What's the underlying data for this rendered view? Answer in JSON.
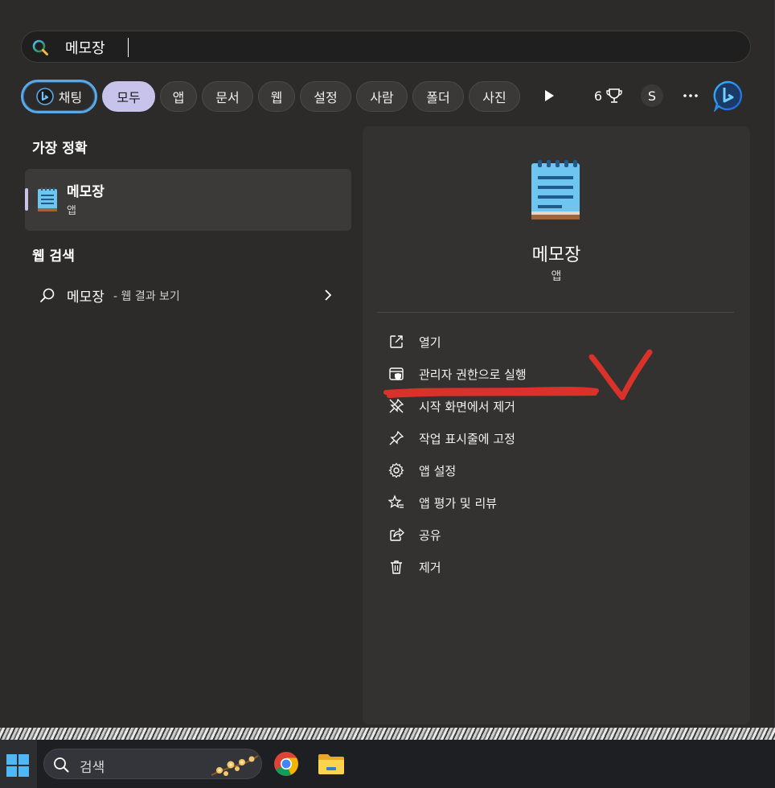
{
  "search": {
    "query": "메모장",
    "icon": "search-icon"
  },
  "filters": {
    "chat": "채팅",
    "items": [
      "모두",
      "앱",
      "문서",
      "웹",
      "설정",
      "사람",
      "폴더",
      "사진"
    ],
    "active": "모두",
    "play_icon": "play-icon",
    "points": "6",
    "points_icon": "rewards-trophy-icon",
    "avatar_letter": "S",
    "more_icon": "more-icon",
    "bing_icon": "bing-icon"
  },
  "best_match": {
    "title": "가장 정확",
    "app_name": "메모장",
    "app_type": "앱",
    "icon": "notepad-icon"
  },
  "web_search": {
    "title": "웹 검색",
    "query": "메모장",
    "suffix": "- 웹 결과 보기",
    "icon": "search-icon",
    "chevron": "chevron-right-icon"
  },
  "detail": {
    "app_name": "메모장",
    "app_type": "앱",
    "actions": [
      {
        "label": "열기",
        "icon": "open-external-icon"
      },
      {
        "label": "관리자 권한으로 실행",
        "icon": "shield-window-icon"
      },
      {
        "label": "시작 화면에서 제거",
        "icon": "unpin-icon"
      },
      {
        "label": "작업 표시줄에 고정",
        "icon": "pin-icon"
      },
      {
        "label": "앱 설정",
        "icon": "gear-icon"
      },
      {
        "label": "앱 평가 및 리뷰",
        "icon": "star-review-icon"
      },
      {
        "label": "공유",
        "icon": "share-icon"
      },
      {
        "label": "제거",
        "icon": "trash-icon"
      }
    ]
  },
  "annotation": {
    "color": "#e8322a",
    "marks": [
      "underline-scribble",
      "checkmark"
    ]
  },
  "taskbar": {
    "search_label": "검색",
    "start_icon": "windows-start-icon",
    "apps": [
      "chrome-icon",
      "file-explorer-icon"
    ]
  },
  "colors": {
    "accent": "#c7c3ea",
    "chat_border": "#5aa9e6",
    "panel_bg": "#2c2b2a"
  }
}
